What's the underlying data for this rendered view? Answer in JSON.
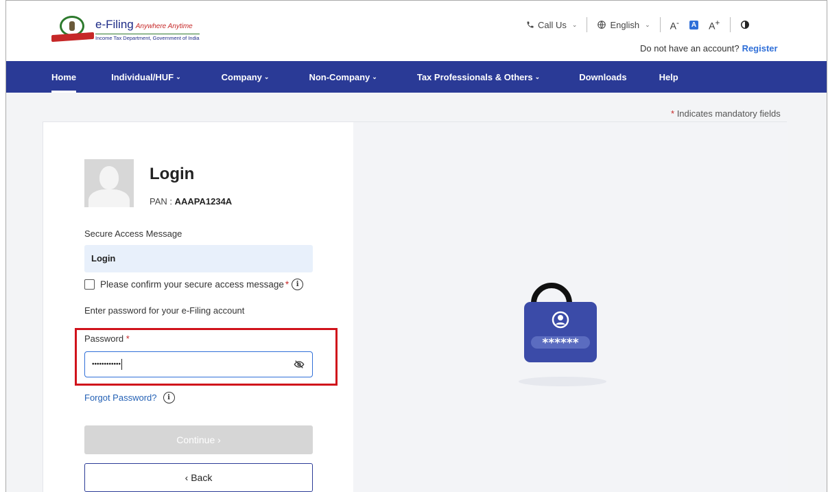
{
  "header": {
    "logo_title": "e-Filing",
    "logo_tagline": "Anywhere Anytime",
    "logo_subtitle": "Income Tax Department, Government of India",
    "call_us": "Call Us",
    "language": "English",
    "font_decrease": "A",
    "font_normal": "A",
    "font_increase": "A",
    "no_account_text": "Do not have an account?",
    "register_link": "Register"
  },
  "nav": {
    "items": [
      {
        "label": "Home",
        "has_dropdown": false
      },
      {
        "label": "Individual/HUF",
        "has_dropdown": true
      },
      {
        "label": "Company",
        "has_dropdown": true
      },
      {
        "label": "Non-Company",
        "has_dropdown": true
      },
      {
        "label": "Tax Professionals & Others",
        "has_dropdown": true
      },
      {
        "label": "Downloads",
        "has_dropdown": false
      },
      {
        "label": "Help",
        "has_dropdown": false
      }
    ]
  },
  "mandatory_note": {
    "star": "*",
    "text": "Indicates mandatory fields"
  },
  "login": {
    "title": "Login",
    "pan_label": "PAN :",
    "pan_value": "AAAPA1234A",
    "secure_message_label": "Secure Access Message",
    "secure_message_value": "Login",
    "confirm_label": "Please confirm your secure access message",
    "enter_password_text": "Enter password for your e-Filing account",
    "password_label": "Password",
    "password_value": "••••••••••••",
    "forgot_password": "Forgot Password?",
    "continue_button": "Continue ›",
    "back_button": "‹ Back"
  },
  "illustration": {
    "masked_text": "******"
  },
  "colors": {
    "nav_bg": "#2a3a96",
    "accent": "#2f6fd8",
    "required": "#c62828",
    "highlight_border": "#d0121b",
    "lock_body": "#3b4ba8"
  }
}
